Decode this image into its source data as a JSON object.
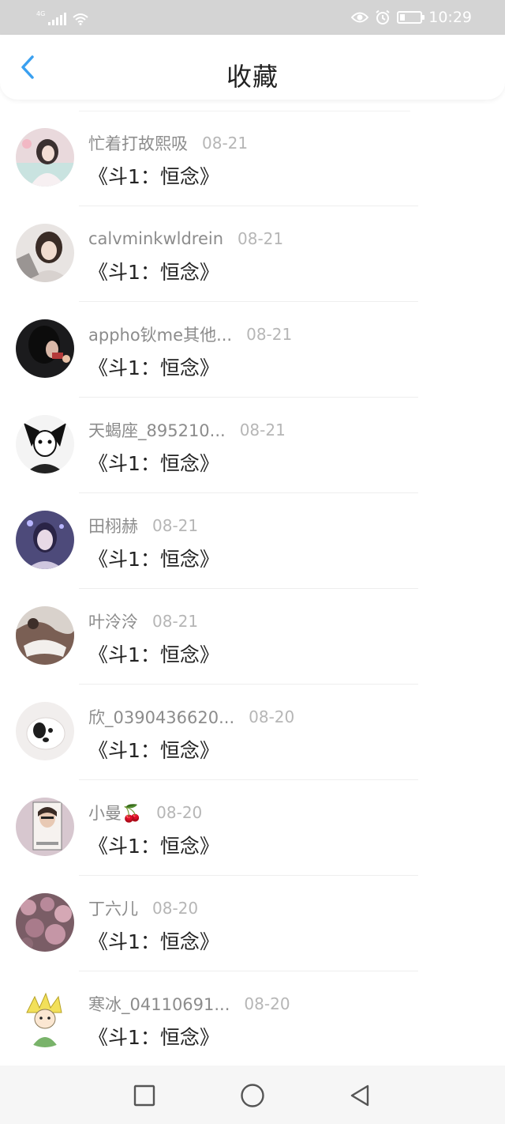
{
  "status_bar": {
    "network": "4G",
    "time": "10:29",
    "icons": [
      "signal-icon",
      "wifi-icon",
      "eye-icon",
      "alarm-icon",
      "battery-icon"
    ]
  },
  "header": {
    "title": "收藏",
    "back_icon": "chevron-left-icon"
  },
  "items": [
    {
      "name": "忙着打故熙吸",
      "date": "08-21",
      "title": "《斗1：恒念》"
    },
    {
      "name": "calvminkwldrein",
      "date": "08-21",
      "title": "《斗1：恒念》"
    },
    {
      "name": "appho钬me其他...",
      "date": "08-21",
      "title": "《斗1：恒念》"
    },
    {
      "name": "天蝎座_895210...",
      "date": "08-21",
      "title": "《斗1：恒念》"
    },
    {
      "name": "田栩赫",
      "date": "08-21",
      "title": "《斗1：恒念》"
    },
    {
      "name": "叶泠泠",
      "date": "08-21",
      "title": "《斗1：恒念》"
    },
    {
      "name": "欣_0390436620...",
      "date": "08-20",
      "title": "《斗1：恒念》"
    },
    {
      "name": "小曼🍒",
      "date": "08-20",
      "title": "《斗1：恒念》"
    },
    {
      "name": "丁六儿",
      "date": "08-20",
      "title": "《斗1：恒念》"
    },
    {
      "name": "寒冰_04110691...",
      "date": "08-20",
      "title": "《斗1：恒念》"
    }
  ],
  "nav_bar": {
    "icons": [
      "recent-apps-icon",
      "home-icon",
      "back-icon"
    ]
  },
  "colors": {
    "accent": "#3aa0f0",
    "status_bar": "#d4d4d4",
    "name_text": "#8c8c8c",
    "date_text": "#b6b6b6"
  }
}
